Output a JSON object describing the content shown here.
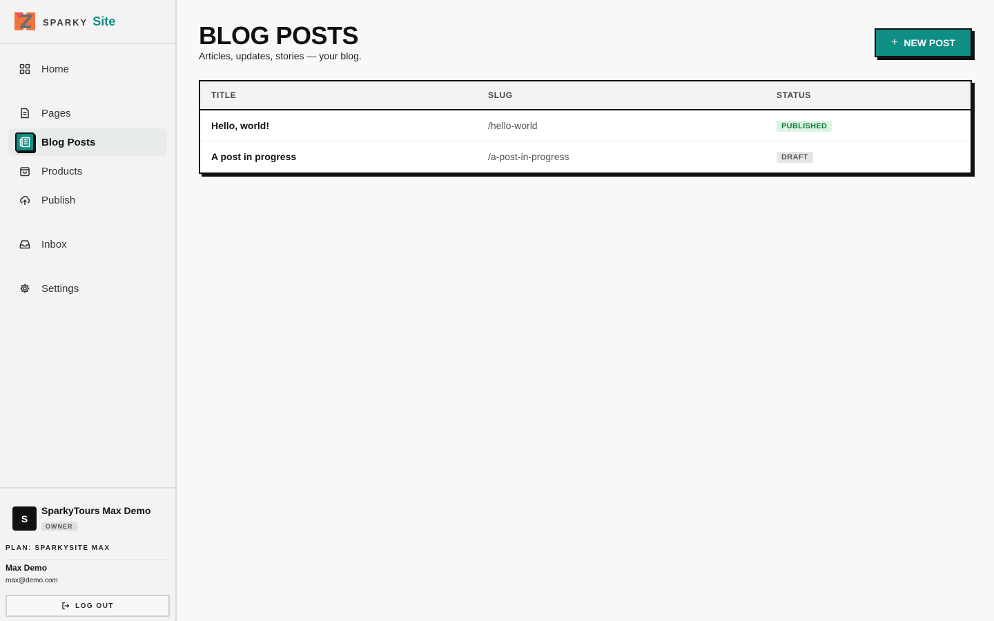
{
  "brand": {
    "word": "SPARKY",
    "site": "Site"
  },
  "sidebar": {
    "items": [
      {
        "label": "Home",
        "icon": "grid-icon"
      },
      {
        "label": "Pages",
        "icon": "document-icon"
      },
      {
        "label": "Blog Posts",
        "icon": "newspaper-icon",
        "active": true
      },
      {
        "label": "Products",
        "icon": "shopping-bag-icon"
      },
      {
        "label": "Publish",
        "icon": "cloud-upload-icon"
      },
      {
        "label": "Inbox",
        "icon": "inbox-icon"
      },
      {
        "label": "Settings",
        "icon": "gear-icon"
      }
    ]
  },
  "account": {
    "avatar_letter": "S",
    "name": "SparkyTours Max Demo",
    "role": "OWNER",
    "plan": "PLAN: SPARKYSITE MAX"
  },
  "user": {
    "name": "Max Demo",
    "email": "max@demo.com"
  },
  "logout_label": "LOG OUT",
  "main": {
    "title": "BLOG POSTS",
    "subtitle": "Articles, updates, stories — your blog.",
    "new_post_label": "NEW POST"
  },
  "table": {
    "headers": {
      "title": "TITLE",
      "slug": "SLUG",
      "status": "STATUS"
    },
    "rows": [
      {
        "title": "Hello, world!",
        "slug": "/hello-world",
        "status": "PUBLISHED"
      },
      {
        "title": "A post in progress",
        "slug": "/a-post-in-progress",
        "status": "DRAFT"
      }
    ]
  },
  "colors": {
    "accent": "#0f8f84",
    "published_bg": "#dcf5e3",
    "published_fg": "#0b7a32",
    "draft_bg": "#e6e6e6"
  }
}
